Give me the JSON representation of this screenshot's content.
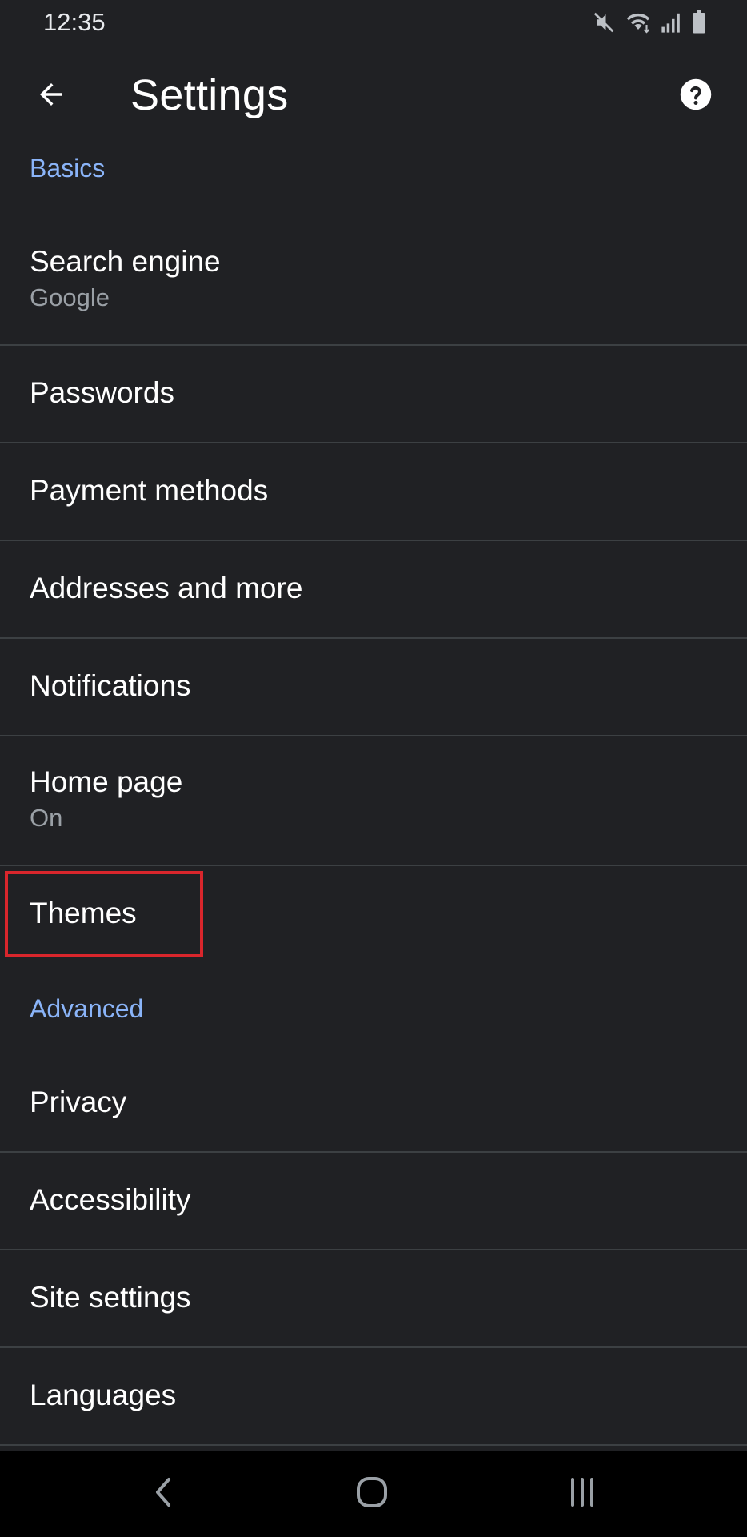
{
  "status_bar": {
    "time": "12:35",
    "icons": [
      "mute-icon",
      "wifi-icon",
      "signal-icon",
      "battery-icon"
    ]
  },
  "app_bar": {
    "title": "Settings",
    "back_icon": "arrow-back-icon",
    "help_icon": "help-icon"
  },
  "sections": {
    "basics": "Basics",
    "advanced": "Advanced"
  },
  "items": {
    "search_engine": {
      "title": "Search engine",
      "summary": "Google"
    },
    "passwords": {
      "title": "Passwords"
    },
    "payment_methods": {
      "title": "Payment methods"
    },
    "addresses": {
      "title": "Addresses and more"
    },
    "notifications": {
      "title": "Notifications"
    },
    "home_page": {
      "title": "Home page",
      "summary": "On"
    },
    "themes": {
      "title": "Themes"
    },
    "privacy": {
      "title": "Privacy"
    },
    "accessibility": {
      "title": "Accessibility"
    },
    "site_settings": {
      "title": "Site settings"
    },
    "languages": {
      "title": "Languages"
    }
  },
  "nav_bar": {
    "icons": [
      "nav-back-icon",
      "nav-home-icon",
      "nav-recents-icon"
    ]
  },
  "colors": {
    "background": "#202124",
    "accent": "#8ab4f8",
    "divider": "#3c4043",
    "highlight": "#d9262c"
  }
}
